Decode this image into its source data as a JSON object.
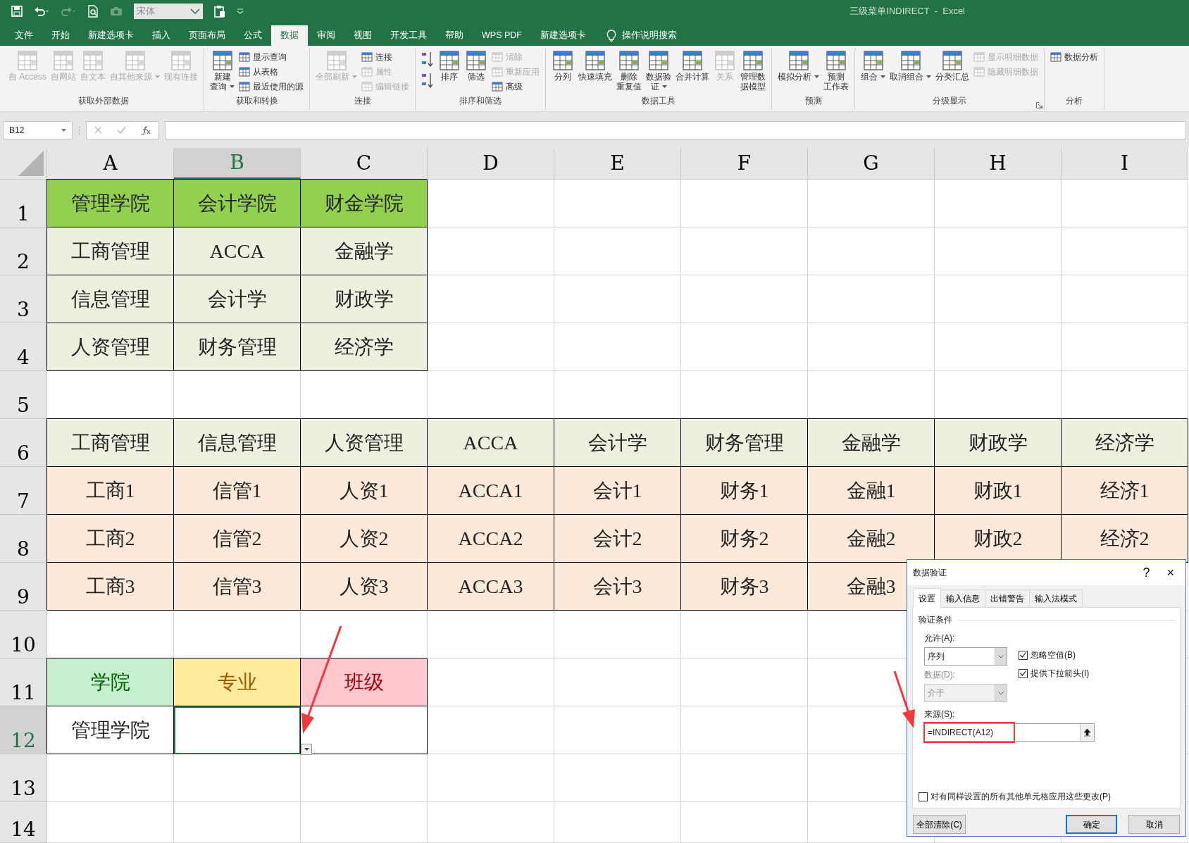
{
  "quick_access": {
    "font_box": "宋体"
  },
  "window_title": "三级菜单INDIRECT  -  Excel",
  "tabs": [
    {
      "label": "文件",
      "selected": false
    },
    {
      "label": "开始",
      "selected": false
    },
    {
      "label": "新建选项卡",
      "selected": false
    },
    {
      "label": "插入",
      "selected": false
    },
    {
      "label": "页面布局",
      "selected": false
    },
    {
      "label": "公式",
      "selected": false
    },
    {
      "label": "数据",
      "selected": true
    },
    {
      "label": "审阅",
      "selected": false
    },
    {
      "label": "视图",
      "selected": false
    },
    {
      "label": "开发工具",
      "selected": false
    },
    {
      "label": "帮助",
      "selected": false
    },
    {
      "label": "WPS PDF",
      "selected": false
    },
    {
      "label": "新建选项卡",
      "selected": false
    }
  ],
  "tell_me": "操作说明搜索",
  "ribbon": [
    {
      "label": "获取外部数据",
      "items": [
        {
          "kind": "large",
          "lines": [
            "自 Access"
          ],
          "disabled": true
        },
        {
          "kind": "large",
          "lines": [
            "自网站"
          ],
          "disabled": true
        },
        {
          "kind": "large",
          "lines": [
            "自文本"
          ],
          "disabled": true
        },
        {
          "kind": "large",
          "lines": [
            "自其他来源"
          ],
          "disabled": true,
          "dropdown": true
        },
        {
          "kind": "large",
          "lines": [
            "现有连接"
          ],
          "disabled": true
        }
      ]
    },
    {
      "label": "获取和转换",
      "items": [
        {
          "kind": "large",
          "lines": [
            "新建",
            "查询"
          ],
          "disabled": false,
          "dropdown": true
        },
        {
          "kind": "small",
          "label": "显示查询",
          "disabled": false
        },
        {
          "kind": "small",
          "label": "从表格",
          "disabled": false
        },
        {
          "kind": "small",
          "label": "最近使用的源",
          "disabled": false
        }
      ]
    },
    {
      "label": "连接",
      "items": [
        {
          "kind": "large",
          "lines": [
            "全部刷新"
          ],
          "disabled": true,
          "dropdown": true
        },
        {
          "kind": "small",
          "label": "连接",
          "disabled": false
        },
        {
          "kind": "small",
          "label": "属性",
          "disabled": true
        },
        {
          "kind": "small",
          "label": "编辑链接",
          "disabled": true
        }
      ]
    },
    {
      "label": "排序和筛选",
      "items": [
        {
          "kind": "icon",
          "disabled": false
        },
        {
          "kind": "icon",
          "disabled": false
        },
        {
          "kind": "large",
          "lines": [
            "排序"
          ],
          "disabled": false
        },
        {
          "kind": "large",
          "lines": [
            "筛选"
          ],
          "disabled": false
        },
        {
          "kind": "small",
          "label": "清除",
          "disabled": true
        },
        {
          "kind": "small",
          "label": "重新应用",
          "disabled": true
        },
        {
          "kind": "small",
          "label": "高级",
          "disabled": false
        }
      ]
    },
    {
      "label": "数据工具",
      "items": [
        {
          "kind": "large",
          "lines": [
            "分列"
          ],
          "disabled": false
        },
        {
          "kind": "large",
          "lines": [
            "快速填充"
          ],
          "disabled": false
        },
        {
          "kind": "large",
          "lines": [
            "删除",
            "重复值"
          ],
          "disabled": false
        },
        {
          "kind": "large",
          "lines": [
            "数据验",
            "证"
          ],
          "disabled": false,
          "dropdown": true
        },
        {
          "kind": "large",
          "lines": [
            "合并计算"
          ],
          "disabled": false
        },
        {
          "kind": "large",
          "lines": [
            "关系"
          ],
          "disabled": true
        },
        {
          "kind": "large",
          "lines": [
            "管理数",
            "据模型"
          ],
          "disabled": false
        }
      ]
    },
    {
      "label": "预测",
      "items": [
        {
          "kind": "large",
          "lines": [
            "模拟分析"
          ],
          "disabled": false,
          "dropdown": true
        },
        {
          "kind": "large",
          "lines": [
            "预测",
            "工作表"
          ],
          "disabled": false
        }
      ]
    },
    {
      "label": "分级显示",
      "launcher": true,
      "items": [
        {
          "kind": "large",
          "lines": [
            "组合"
          ],
          "disabled": false,
          "dropdown": true
        },
        {
          "kind": "large",
          "lines": [
            "取消组合"
          ],
          "disabled": false,
          "dropdown": true
        },
        {
          "kind": "large",
          "lines": [
            "分类汇总"
          ],
          "disabled": false
        },
        {
          "kind": "small",
          "label": "显示明细数据",
          "disabled": true
        },
        {
          "kind": "small",
          "label": "隐藏明细数据",
          "disabled": true
        }
      ]
    },
    {
      "label": "分析",
      "items": [
        {
          "kind": "small",
          "label": "数据分析",
          "disabled": false
        }
      ]
    }
  ],
  "formula_bar": {
    "name_box": "B12"
  },
  "sheet": {
    "columns": [
      {
        "label": "A",
        "selected": false
      },
      {
        "label": "B",
        "selected": true
      },
      {
        "label": "C",
        "selected": false
      },
      {
        "label": "D",
        "selected": false
      },
      {
        "label": "E",
        "selected": false
      },
      {
        "label": "F",
        "selected": false
      },
      {
        "label": "G",
        "selected": false
      },
      {
        "label": "H",
        "selected": false
      },
      {
        "label": "I",
        "selected": false
      }
    ],
    "rows": [
      {
        "label": "1",
        "selected": false,
        "cells": [
          {
            "text": "管理学院",
            "color": "#92d050",
            "bordered": true
          },
          {
            "text": "会计学院",
            "color": "#92d050",
            "bordered": true
          },
          {
            "text": "财金学院",
            "color": "#92d050",
            "bordered": true
          }
        ]
      },
      {
        "label": "2",
        "selected": false,
        "cells": [
          {
            "text": "工商管理",
            "color": "#ebf1de",
            "bordered": true
          },
          {
            "text": "ACCA",
            "color": "#ebf1de",
            "bordered": true
          },
          {
            "text": "金融学",
            "color": "#ebf1de",
            "bordered": true
          }
        ]
      },
      {
        "label": "3",
        "selected": false,
        "cells": [
          {
            "text": "信息管理",
            "color": "#ebf1de",
            "bordered": true
          },
          {
            "text": "会计学",
            "color": "#ebf1de",
            "bordered": true
          },
          {
            "text": "财政学",
            "color": "#ebf1de",
            "bordered": true
          }
        ]
      },
      {
        "label": "4",
        "selected": false,
        "cells": [
          {
            "text": "人资管理",
            "color": "#ebf1de",
            "bordered": true
          },
          {
            "text": "财务管理",
            "color": "#ebf1de",
            "bordered": true
          },
          {
            "text": "经济学",
            "color": "#ebf1de",
            "bordered": true
          }
        ]
      },
      {
        "label": "5",
        "selected": false
      },
      {
        "label": "6",
        "selected": false,
        "cells": [
          {
            "text": "工商管理",
            "color": "#ebf1de",
            "bordered": true
          },
          {
            "text": "信息管理",
            "color": "#ebf1de",
            "bordered": true
          },
          {
            "text": "人资管理",
            "color": "#ebf1de",
            "bordered": true
          },
          {
            "text": "ACCA",
            "color": "#ebf1de",
            "bordered": true
          },
          {
            "text": "会计学",
            "color": "#ebf1de",
            "bordered": true
          },
          {
            "text": "财务管理",
            "color": "#ebf1de",
            "bordered": true
          },
          {
            "text": "金融学",
            "color": "#ebf1de",
            "bordered": true
          },
          {
            "text": "财政学",
            "color": "#ebf1de",
            "bordered": true
          },
          {
            "text": "经济学",
            "color": "#ebf1de",
            "bordered": true
          }
        ]
      },
      {
        "label": "7",
        "selected": false,
        "cells": [
          {
            "text": "工商1",
            "color": "#fde9d9",
            "bordered": true
          },
          {
            "text": "信管1",
            "color": "#fde9d9",
            "bordered": true
          },
          {
            "text": "人资1",
            "color": "#fde9d9",
            "bordered": true
          },
          {
            "text": "ACCA1",
            "color": "#fde9d9",
            "bordered": true
          },
          {
            "text": "会计1",
            "color": "#fde9d9",
            "bordered": true
          },
          {
            "text": "财务1",
            "color": "#fde9d9",
            "bordered": true
          },
          {
            "text": "金融1",
            "color": "#fde9d9",
            "bordered": true
          },
          {
            "text": "财政1",
            "color": "#fde9d9",
            "bordered": true
          },
          {
            "text": "经济1",
            "color": "#fde9d9",
            "bordered": true
          }
        ]
      },
      {
        "label": "8",
        "selected": false,
        "cells": [
          {
            "text": "工商2",
            "color": "#fde9d9",
            "bordered": true
          },
          {
            "text": "信管2",
            "color": "#fde9d9",
            "bordered": true
          },
          {
            "text": "人资2",
            "color": "#fde9d9",
            "bordered": true
          },
          {
            "text": "ACCA2",
            "color": "#fde9d9",
            "bordered": true
          },
          {
            "text": "会计2",
            "color": "#fde9d9",
            "bordered": true
          },
          {
            "text": "财务2",
            "color": "#fde9d9",
            "bordered": true
          },
          {
            "text": "金融2",
            "color": "#fde9d9",
            "bordered": true
          },
          {
            "text": "财政2",
            "color": "#fde9d9",
            "bordered": true
          },
          {
            "text": "经济2",
            "color": "#fde9d9",
            "bordered": true
          }
        ]
      },
      {
        "label": "9",
        "selected": false,
        "cells": [
          {
            "text": "工商3",
            "color": "#fde9d9",
            "bordered": true
          },
          {
            "text": "信管3",
            "color": "#fde9d9",
            "bordered": true
          },
          {
            "text": "人资3",
            "color": "#fde9d9",
            "bordered": true
          },
          {
            "text": "ACCA3",
            "color": "#fde9d9",
            "bordered": true
          },
          {
            "text": "会计3",
            "color": "#fde9d9",
            "bordered": true
          },
          {
            "text": "财务3",
            "color": "#fde9d9",
            "bordered": true
          },
          {
            "text": "金融3",
            "color": "#fde9d9",
            "bordered": true
          }
        ]
      },
      {
        "label": "10",
        "selected": false
      },
      {
        "label": "11",
        "selected": false,
        "cells": [
          {
            "text": "学院",
            "kind": "good",
            "bordered": true
          },
          {
            "text": "专业",
            "kind": "neutral",
            "bordered": true
          },
          {
            "text": "班级",
            "kind": "bad",
            "bordered": true
          }
        ]
      },
      {
        "label": "12",
        "selected": true,
        "cells": [
          {
            "text": "管理学院",
            "bordered": true
          },
          {
            "bordered": true,
            "dropdown": true
          },
          {
            "bordered": true
          }
        ]
      },
      {
        "label": "13",
        "selected": false
      },
      {
        "label": "14",
        "selected": false
      }
    ]
  },
  "dialog": {
    "title": "数据验证",
    "help": "?",
    "close": "×",
    "tabs": [
      {
        "label": "设置",
        "selected": true
      },
      {
        "label": "输入信息",
        "selected": false
      },
      {
        "label": "出错警告",
        "selected": false
      },
      {
        "label": "输入法模式",
        "selected": false
      }
    ],
    "section": "验证条件",
    "allow": {
      "label": "允许(A):",
      "value": "序列",
      "disabled": false
    },
    "data": {
      "label": "数据(D):",
      "value": "介于",
      "disabled": true
    },
    "checkboxes": [
      {
        "label": "忽略空值(B)",
        "checked": true
      },
      {
        "label": "提供下拉箭头(I)",
        "checked": true
      }
    ],
    "source": {
      "label": "来源(S):",
      "value": "=INDIRECT(A12)"
    },
    "apply_all": {
      "label": "对有同样设置的所有其他单元格应用这些更改(P)",
      "checked": false
    },
    "buttons": [
      {
        "label": "全部清除(C)",
        "default": false
      },
      {
        "label": "确定",
        "default": true
      },
      {
        "label": "取消",
        "default": false
      }
    ]
  }
}
